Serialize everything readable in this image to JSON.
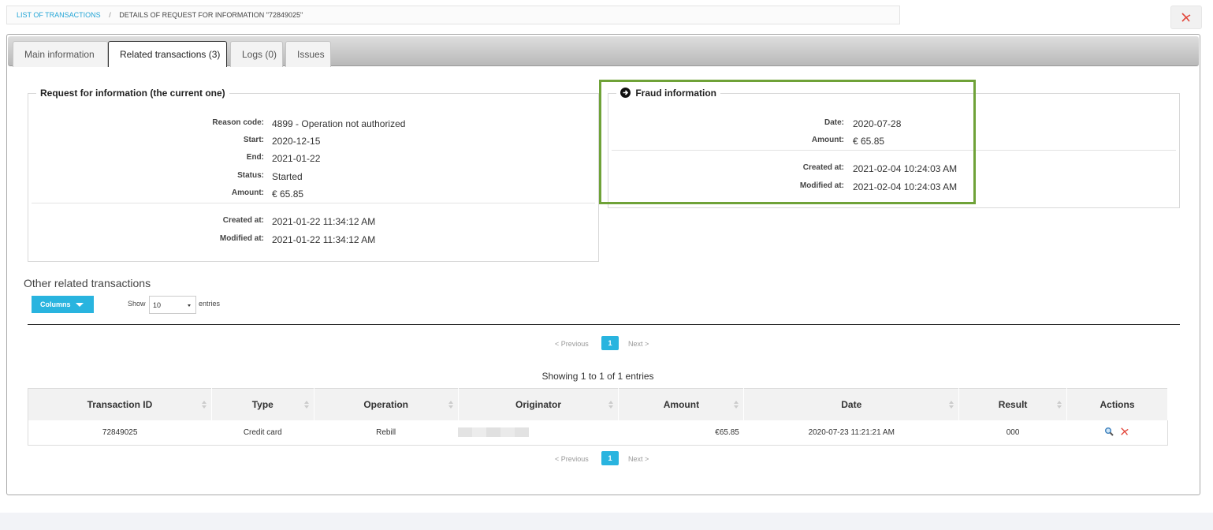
{
  "breadcrumb": {
    "parent": "LIST OF TRANSACTIONS",
    "separator": "/",
    "current": "DETAILS OF REQUEST FOR INFORMATION \"72849025\""
  },
  "tabs": [
    {
      "label": "Main information"
    },
    {
      "label": "Related transactions (3)"
    },
    {
      "label": "Logs (0)"
    },
    {
      "label": "Issues"
    }
  ],
  "rfi": {
    "legend": "Request for information (the current one)",
    "fields": [
      {
        "key": "Reason code:",
        "value": "4899 - Operation not authorized"
      },
      {
        "key": "Start:",
        "value": "2020-12-15"
      },
      {
        "key": "End:",
        "value": "2021-01-22"
      },
      {
        "key": "Status:",
        "value": "Started"
      },
      {
        "key": "Amount:",
        "value": "€ 65.85"
      }
    ],
    "meta": [
      {
        "key": "Created at:",
        "value": "2021-01-22 11:34:12 AM"
      },
      {
        "key": "Modified at:",
        "value": "2021-01-22 11:34:12 AM"
      }
    ]
  },
  "fraud": {
    "legend": "Fraud information",
    "fields": [
      {
        "key": "Date:",
        "value": "2020-07-28"
      },
      {
        "key": "Amount:",
        "value": "€ 65.85"
      }
    ],
    "meta": [
      {
        "key": "Created at:",
        "value": "2021-02-04 10:24:03 AM"
      },
      {
        "key": "Modified at:",
        "value": "2021-02-04 10:24:03 AM"
      }
    ]
  },
  "related": {
    "title": "Other related transactions",
    "columns_button": "Columns",
    "show_label": "Show",
    "page_size": "10",
    "entries_label": "entries",
    "pager": {
      "previous": "< Previous",
      "page": "1",
      "next": "Next >"
    },
    "info": "Showing 1 to 1 of 1 entries",
    "headers": [
      "Transaction ID",
      "Type",
      "Operation",
      "Originator",
      "Amount",
      "Date",
      "Result",
      "Actions"
    ],
    "rows": [
      {
        "transaction_id": "72849025",
        "type": "Credit card",
        "operation": "Rebill",
        "originator": "",
        "amount": "€65.85",
        "date": "2020-07-23 11:21:21 AM",
        "result": "000"
      }
    ]
  },
  "icons": {
    "pdf": "pdf-icon",
    "search": "magnifier-icon",
    "fraud_arrow": "circle-arrow-right-icon"
  },
  "colors": {
    "accent": "#29b4df",
    "highlight": "#6fa238",
    "pdf_red": "#e2463a"
  }
}
